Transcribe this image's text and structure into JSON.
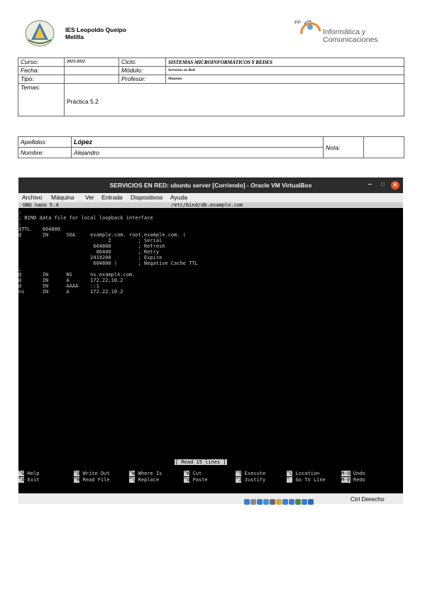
{
  "header": {
    "school_line1": "IES Leopoldo Queipo",
    "school_line2": "Melilla",
    "dept_line1": "Informática y",
    "dept_line2": "Comunicaciones",
    "logo_fp": "FP"
  },
  "info_table": {
    "curso_label": "Curso:",
    "curso_value": "2021-2022",
    "ciclo_label": "Ciclo:",
    "ciclo_value": "SISTEMAS MICROINFORMÁTICOS Y REDES",
    "fecha_label": "Fecha:",
    "fecha_value": "",
    "modulo_label": "Módulo:",
    "modulo_value": "Servicios en Red",
    "tipo_label": "Tipo:",
    "tipo_value": "",
    "profesor_label": "Profesor:",
    "profesor_value": "Maanan",
    "temas_label": "Temas:",
    "temas_value": "Práctica 5.2"
  },
  "student_table": {
    "apellidos_label": "Apellidos:",
    "apellidos_value": "López",
    "nombre_label": "Nombre:",
    "nombre_value": "Alejandro",
    "nota_label": "Nota:",
    "nota_value": ""
  },
  "vm_window": {
    "title": "SERVICIOS EN RED: ubuntu server [Corriendo] - Oracle VM VirtualBox",
    "minimize": "–",
    "maximize": "□",
    "close": "✕",
    "menu": [
      "Archivo",
      "Máquina",
      "Ver",
      "Entrada",
      "Dispositivos",
      "Ayuda"
    ],
    "nano_version": "GNU nano 5.4",
    "nano_file": "/etc/bind/db.example.com",
    "lines": [
      ";",
      "; BIND data file for local loopback interface",
      ";",
      "$TTL    604800",
      "@       IN      SOA     example.com. root.example.com. (",
      "                              2         ; Serial",
      "                         604800         ; Refresh",
      "                          86400         ; Retry",
      "                        2419200         ; Expire",
      "                         604800 )       ; Negative Cache TTL",
      ";",
      "@       IN      NS      ns.example.com.",
      "@       IN      A       172.22.10.2",
      "@       IN      AAAA    ::1",
      "ns      IN      A       172.22.10.2"
    ],
    "status_msg": "[ Read 15 lines ]",
    "shortcuts_row1": [
      {
        "key": "^G",
        "label": "Help"
      },
      {
        "key": "^O",
        "label": "Write Out"
      },
      {
        "key": "^W",
        "label": "Where Is"
      },
      {
        "key": "^K",
        "label": "Cut"
      },
      {
        "key": "^T",
        "label": "Execute"
      },
      {
        "key": "^C",
        "label": "Location"
      },
      {
        "key": "M-U",
        "label": "Undo"
      }
    ],
    "shortcuts_row2": [
      {
        "key": "^X",
        "label": "Exit"
      },
      {
        "key": "^R",
        "label": "Read File"
      },
      {
        "key": "^\\",
        "label": "Replace"
      },
      {
        "key": "^U",
        "label": "Paste"
      },
      {
        "key": "^J",
        "label": "Justify"
      },
      {
        "key": "^_",
        "label": "Go To Line"
      },
      {
        "key": "M-E",
        "label": "Redo"
      }
    ],
    "host_key": "Ctrl Derecho",
    "status_icons": [
      "hdd-icon",
      "optical-icon",
      "usb-icon",
      "audio-icon",
      "network-icon",
      "shared-folder-icon",
      "display-icon",
      "recording-icon",
      "cpu-icon",
      "mouse-icon",
      "arrow-icon"
    ],
    "status_icon_colors": [
      "#3a7bd5",
      "#888888",
      "#3a7bd5",
      "#4a8fd9",
      "#6a6a6a",
      "#d9a53a",
      "#3a7bd5",
      "#3a7bd5",
      "#4f8a3a",
      "#3a7bd5",
      "#2a6ab5"
    ]
  }
}
